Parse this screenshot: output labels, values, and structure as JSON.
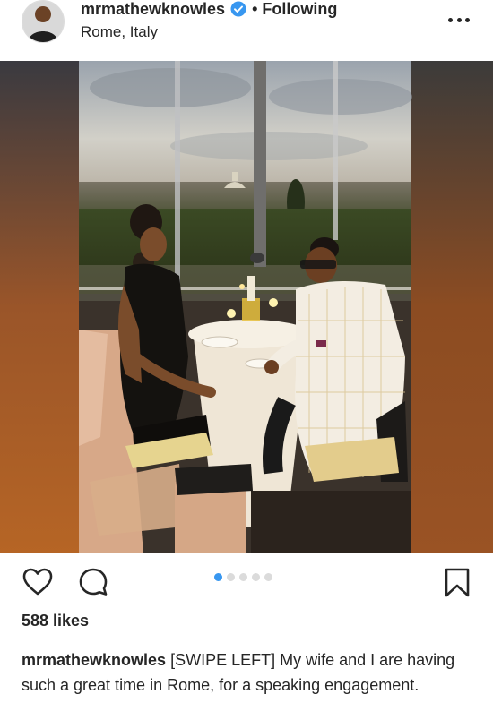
{
  "post": {
    "username": "mrmathewknowles",
    "separator": "•",
    "follow_status": "Following",
    "location": "Rome, Italy",
    "image_index": 1,
    "image_count": 5,
    "likes": "588 likes",
    "caption_user": "mrmathewknowles",
    "caption_text": "[SWIPE LEFT] My wife and I are having such a great time in Rome, for a speaking engagement."
  },
  "colors": {
    "accent": "#3897f0",
    "text": "#262626",
    "dot_inactive": "#dbdbdb"
  },
  "icons": {
    "verified": "verified-badge-icon",
    "more": "more-options-icon",
    "like": "heart-icon",
    "comment": "comment-bubble-icon",
    "save": "bookmark-icon"
  }
}
